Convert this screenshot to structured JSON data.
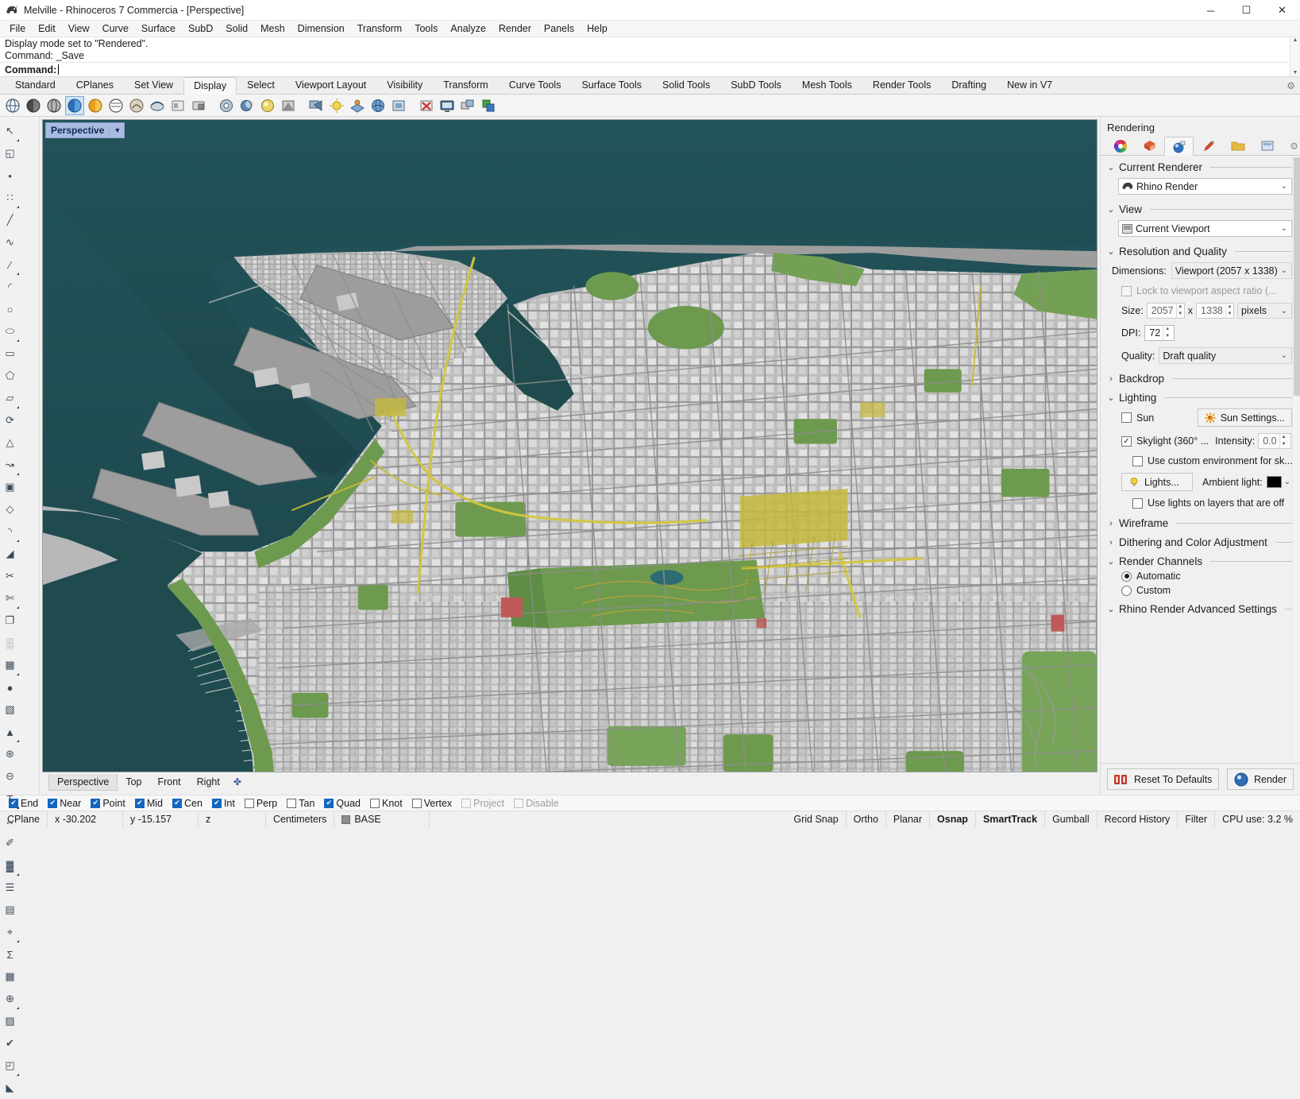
{
  "window": {
    "title": "Melville - Rhinoceros 7 Commercia - [Perspective]",
    "minimize": "─",
    "maximize": "☐",
    "close": "✕"
  },
  "menubar": {
    "items": [
      "File",
      "Edit",
      "View",
      "Curve",
      "Surface",
      "SubD",
      "Solid",
      "Mesh",
      "Dimension",
      "Transform",
      "Tools",
      "Analyze",
      "Render",
      "Panels",
      "Help"
    ]
  },
  "command": {
    "history": [
      "Display mode set to \"Rendered\".",
      "Command: _Save"
    ],
    "prompt": "Command:",
    "value": "",
    "scroll_up": "▲",
    "scroll_down": "▼"
  },
  "toolbar_tabs": {
    "items": [
      "Standard",
      "CPlanes",
      "Set View",
      "Display",
      "Select",
      "Viewport Layout",
      "Visibility",
      "Transform",
      "Curve Tools",
      "Surface Tools",
      "Solid Tools",
      "SubD Tools",
      "Mesh Tools",
      "Render Tools",
      "Drafting",
      "New in V7"
    ],
    "active": "Display",
    "gear": "⚙"
  },
  "viewport": {
    "label": "Perspective",
    "dropdown_arrow": "▼",
    "tabs": [
      "Perspective",
      "Top",
      "Front",
      "Right"
    ],
    "active_tab": "Perspective",
    "add_tab": "✤",
    "background_color": "#1e4a4a",
    "water_color": "#1f4b4e",
    "ground_color": "#a8a8a8",
    "park_color": "#6f9550",
    "road_color": "#d9cf4a"
  },
  "panel": {
    "title": "Rendering",
    "tabs": [
      "color-wheel-icon",
      "materials-icon",
      "rendering-icon",
      "brush-icon",
      "folder-icon",
      "layers-icon"
    ],
    "active_tab_index": 2,
    "gear": "⚙",
    "sections": {
      "current_renderer": {
        "title": "Current Renderer",
        "chevron": "⌄",
        "value": "Rhino Render",
        "arrow": "⌄"
      },
      "view": {
        "title": "View",
        "chevron": "⌄",
        "value": "Current Viewport",
        "arrow": "⌄"
      },
      "resolution": {
        "title": "Resolution and Quality",
        "chevron": "⌄",
        "dimensions_label": "Dimensions:",
        "dimensions_value": "Viewport (2057 x 1338)",
        "lock_label": "Lock to viewport aspect ratio (...",
        "lock_checked": false,
        "size_label": "Size:",
        "size_w": "2057",
        "size_x": "x",
        "size_h": "1338",
        "size_units": "pixels",
        "dpi_label": "DPI:",
        "dpi_value": "72",
        "quality_label": "Quality:",
        "quality_value": "Draft quality"
      },
      "backdrop": {
        "title": "Backdrop",
        "chevron": "›",
        "collapsed": true
      },
      "lighting": {
        "title": "Lighting",
        "chevron": "⌄",
        "sun_label": "Sun",
        "sun_checked": false,
        "sun_settings_button": "Sun Settings...",
        "skylight_label": "Skylight (360° ...",
        "skylight_checked": true,
        "intensity_label": "Intensity:",
        "intensity_value": "0.0",
        "custom_env_label": "Use custom environment for sk...",
        "custom_env_checked": false,
        "lights_button": "Lights...",
        "ambient_label": "Ambient light:",
        "ambient_color": "#000000",
        "ambient_arrow": "⌄",
        "layers_off_label": "Use lights on layers that are off",
        "layers_off_checked": false
      },
      "wireframe": {
        "title": "Wireframe",
        "chevron": "›",
        "collapsed": true
      },
      "dithering": {
        "title": "Dithering and Color Adjustment",
        "chevron": "›",
        "collapsed": true
      },
      "render_channels": {
        "title": "Render Channels",
        "chevron": "⌄",
        "options": [
          "Automatic",
          "Custom"
        ],
        "selected": "Automatic"
      },
      "advanced": {
        "title": "Rhino Render Advanced Settings",
        "chevron": "⌄"
      }
    },
    "footer": {
      "reset_button": "Reset To Defaults",
      "render_button": "Render"
    }
  },
  "osnap": {
    "items": [
      {
        "label": "End",
        "checked": true
      },
      {
        "label": "Near",
        "checked": true
      },
      {
        "label": "Point",
        "checked": true
      },
      {
        "label": "Mid",
        "checked": true
      },
      {
        "label": "Cen",
        "checked": true
      },
      {
        "label": "Int",
        "checked": true
      },
      {
        "label": "Perp",
        "checked": false
      },
      {
        "label": "Tan",
        "checked": false
      },
      {
        "label": "Quad",
        "checked": true
      },
      {
        "label": "Knot",
        "checked": false
      },
      {
        "label": "Vertex",
        "checked": false
      },
      {
        "label": "Project",
        "checked": false,
        "dim": true
      },
      {
        "label": "Disable",
        "checked": false,
        "dim": true
      }
    ],
    "check_glyph": "✔"
  },
  "status": {
    "cplane": "CPlane",
    "x": "x -30.202",
    "y": "y -15.157",
    "z": "z",
    "units": "Centimeters",
    "layer": "BASE",
    "layer_color": "#8d8d8d",
    "grid_snap": "Grid Snap",
    "ortho": "Ortho",
    "planar": "Planar",
    "osnap": "Osnap",
    "smarttrack": "SmartTrack",
    "gumball": "Gumball",
    "record_history": "Record History",
    "filter": "Filter",
    "cpu": "CPU use: 3.2 %"
  },
  "icon_toolbar": {
    "items": [
      "wireframe-display-icon",
      "shaded-display-icon",
      "ghosted-display-icon",
      "xray-display-icon",
      "rendered-display-icon",
      "technical-display-icon",
      "artistic-display-icon",
      "pen-display-icon",
      "arctic-display-icon",
      "raytraced-display-icon",
      "display-options-icon",
      "shade-icon",
      "render-preview-icon",
      "flat-shade-icon",
      "render-icon",
      "sun-icon",
      "ground-plane-icon",
      "environment-icon",
      "render-window-icon",
      "cancel-render-icon",
      "fullscreen-icon",
      "named-views-icon",
      "shadows-icon"
    ]
  },
  "left_tools": {
    "items": [
      "select-arrow-icon",
      "select-window-icon",
      "points-icon",
      "point-cloud-icon",
      "polyline-icon",
      "curve-icon",
      "line-icon",
      "arc-icon",
      "circle-icon",
      "ellipse-icon",
      "rectangle-icon",
      "polygon-icon",
      "surface-icon",
      "revolve-icon",
      "loft-icon",
      "sweep-icon",
      "extrude-icon",
      "patch-icon",
      "fillet-icon",
      "chamfer-icon",
      "trim-icon",
      "split-icon",
      "offset-icon",
      "array-icon",
      "box-icon",
      "sphere-icon",
      "cylinder-icon",
      "cone-icon",
      "boolean-union-icon",
      "boolean-difference-icon",
      "text-icon",
      "dimension-icon",
      "annotate-icon",
      "hatch-icon",
      "layers-icon",
      "block-icon",
      "analyze-icon",
      "mass-properties-icon",
      "grid-icon",
      "gumball-icon",
      "mesh-icon",
      "checkmark-icon",
      "surface-tools-icon",
      "shade-tools-icon"
    ]
  }
}
